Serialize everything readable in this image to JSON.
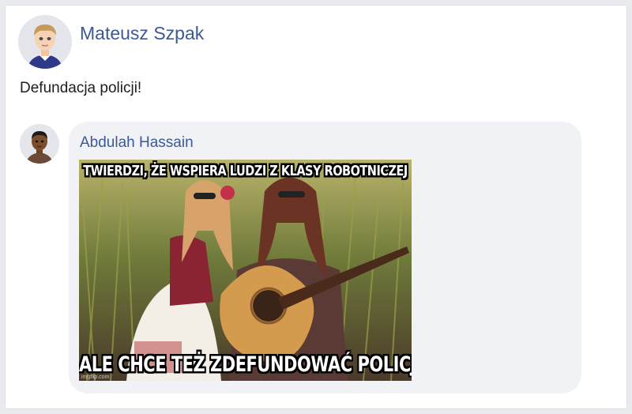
{
  "post": {
    "author": "Mateusz Szpak",
    "text": "Defundacja policji!"
  },
  "comment": {
    "author": "Abdulah Hassain",
    "meme": {
      "top_text": "TWIERDZI, ŻE WSPIERA LUDZI Z KLASY ROBOTNICZEJ",
      "bottom_text": "ALE CHCE TEŻ ZDEFUNDOWAĆ POLICJĘ",
      "watermark": "imgflip.com"
    }
  },
  "colors": {
    "link": "#3b5998",
    "bubble": "#f0f2f5"
  },
  "icons": {
    "post_avatar": "cartoon-man-avatar-icon",
    "comment_avatar": "cartoon-man-avatar-icon"
  }
}
